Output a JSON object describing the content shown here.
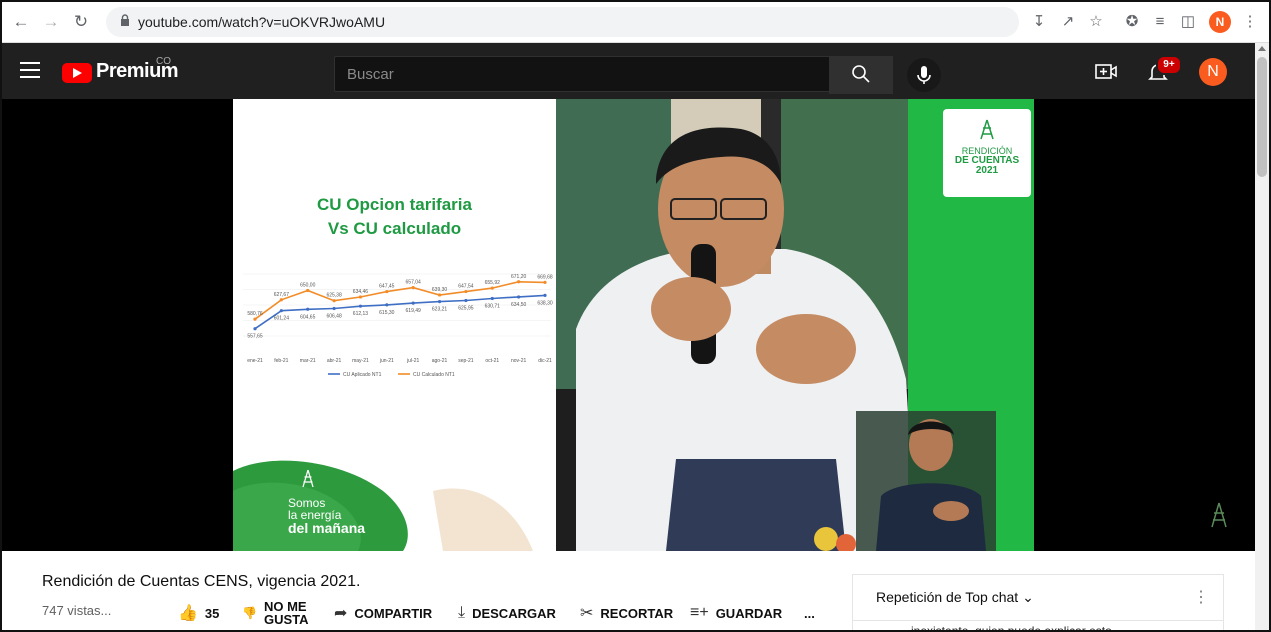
{
  "browser": {
    "url": "youtube.com/watch?v=uOKVRJwoAMU",
    "profile_initial": "N"
  },
  "youtube": {
    "brand": "Premium",
    "country": "CO",
    "search_placeholder": "Buscar",
    "notifications": "9+",
    "avatar_initial": "N"
  },
  "slide": {
    "title_line1": "CU Opcion tarifaria",
    "title_line2": "Vs CU calculado",
    "footer_line1": "Somos",
    "footer_line2": "la energía",
    "footer_line3": "del mañana",
    "accent_color": "#1f9a43"
  },
  "chart_data": {
    "type": "line",
    "categories": [
      "ene-21",
      "feb-21",
      "mar-21",
      "abr-21",
      "may-21",
      "jun-21",
      "jul-21",
      "ago-21",
      "sep-21",
      "oct-21",
      "nov-21",
      "dic-21"
    ],
    "series": [
      {
        "name": "CU Aplicado NT1",
        "values": [
          557.65,
          601.24,
          604.65,
          606.48,
          612.13,
          615.3,
          619.49,
          623.21,
          625.95,
          630.71,
          634.5,
          638.3
        ],
        "color": "#3f6fc4"
      },
      {
        "name": "CU Calculado NT1",
        "values": [
          580.76,
          627.67,
          650.0,
          625.38,
          634.46,
          647.45,
          657.04,
          639.3,
          647.54,
          655.92,
          671.2,
          669.68
        ],
        "color": "#f28c28"
      }
    ],
    "ylim": [
      540,
      690
    ],
    "grid": true,
    "legend": "bottom"
  },
  "camera": {
    "card_line1": "RENDICIÓN",
    "card_line2": "DE CUENTAS",
    "card_line3": "2021"
  },
  "video": {
    "title": "Rendición de Cuentas CENS, vigencia 2021.",
    "views": "747 vistas...",
    "likes": "35",
    "dislike_label_1": "NO ME",
    "dislike_label_2": "GUSTA",
    "share": "COMPARTIR",
    "download": "DESCARGAR",
    "clip": "RECORTAR",
    "save": "GUARDAR",
    "more": "..."
  },
  "chat": {
    "title": "Repetición de Top chat",
    "message": "inexistente, quien puede explicar esto"
  }
}
